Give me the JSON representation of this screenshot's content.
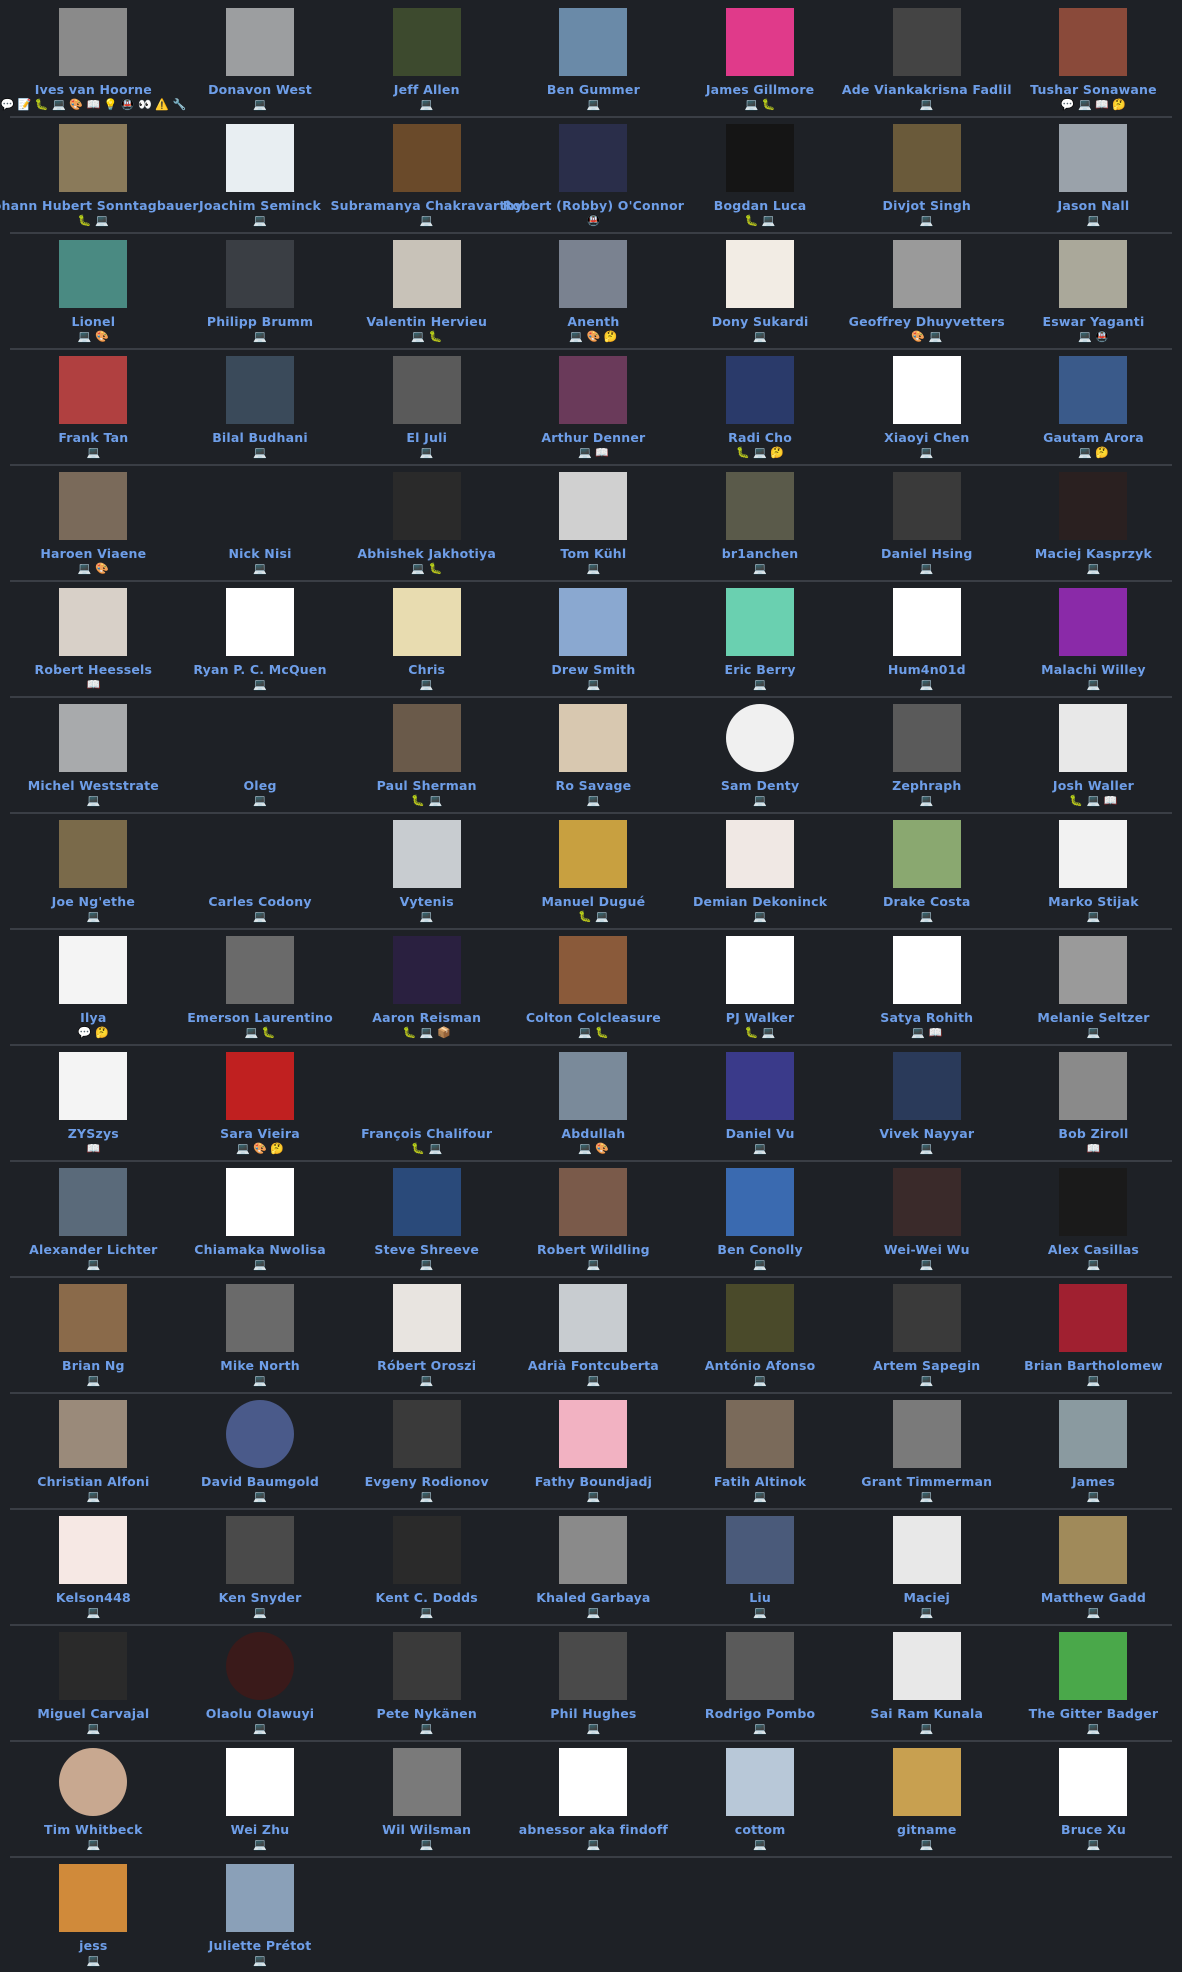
{
  "contributors": [
    {
      "name": "Ives van Hoorne",
      "badges": "💬 📝 🐛 💻 🎨 📖 💡 🚇 👀 ⚠️ 🔧",
      "color": "#8a8a8a"
    },
    {
      "name": "Donavon West",
      "badges": "💻",
      "color": "#9c9ea0"
    },
    {
      "name": "Jeff Allen",
      "badges": "💻",
      "color": "#3d4a2e"
    },
    {
      "name": "Ben Gummer",
      "badges": "💻",
      "color": "#6a8aa8"
    },
    {
      "name": "James Gillmore",
      "badges": "💻 🐛",
      "color": "#e03a8a"
    },
    {
      "name": "Ade Viankakrisna Fadlil",
      "badges": "💻",
      "color": "#444444"
    },
    {
      "name": "Tushar Sonawane",
      "badges": "💬 💻 📖 🤔",
      "color": "#8a4a3a"
    },
    {
      "name": "Johann Hubert Sonntagbauer",
      "badges": "🐛 💻",
      "color": "#8a7a5a"
    },
    {
      "name": "Joachim Seminck",
      "badges": "💻",
      "color": "#e8eef2"
    },
    {
      "name": "Subramanya Chakravarthy",
      "badges": "💻",
      "color": "#6a4a2a"
    },
    {
      "name": "Robert (Robby) O'Connor",
      "badges": "🚇",
      "color": "#2a2e4a"
    },
    {
      "name": "Bogdan Luca",
      "badges": "🐛 💻",
      "color": "#151515"
    },
    {
      "name": "Divjot Singh",
      "badges": "💻",
      "color": "#6a5a3a"
    },
    {
      "name": "Jason Nall",
      "badges": "💻",
      "color": "#9aa2aa"
    },
    {
      "name": "Lionel",
      "badges": "💻 🎨",
      "color": "#4a8a82"
    },
    {
      "name": "Philipp Brumm",
      "badges": "💻",
      "color": "#3a3e44"
    },
    {
      "name": "Valentin Hervieu",
      "badges": "💻 🐛",
      "color": "#c8c2b8"
    },
    {
      "name": "Anenth",
      "badges": "💻 🎨 🤔",
      "color": "#7a8290"
    },
    {
      "name": "Dony Sukardi",
      "badges": "💻",
      "color": "#f2ece4"
    },
    {
      "name": "Geoffrey Dhuyvetters",
      "badges": "🎨 💻",
      "color": "#9a9a9a"
    },
    {
      "name": "Eswar Yaganti",
      "badges": "💻 🚇",
      "color": "#aaa89a"
    },
    {
      "name": "Frank Tan",
      "badges": "💻",
      "color": "#b04040"
    },
    {
      "name": "Bilal Budhani",
      "badges": "💻",
      "color": "#3a4a5a"
    },
    {
      "name": "El Juli",
      "badges": "💻",
      "color": "#5a5a5a"
    },
    {
      "name": "Arthur Denner",
      "badges": "💻 📖",
      "color": "#6a3a5a"
    },
    {
      "name": "Radi Cho",
      "badges": "🐛 💻 🤔",
      "color": "#2a3a6a"
    },
    {
      "name": "Xiaoyi Chen",
      "badges": "💻",
      "color": "#ffffff"
    },
    {
      "name": "Gautam Arora",
      "badges": "💻 🤔",
      "color": "#3a5a8a"
    },
    {
      "name": "Haroen Viaene",
      "badges": "💻 🎨",
      "color": "#7a6a5a"
    },
    {
      "name": "Nick Nisi",
      "badges": "💻",
      "color": "#1e2126"
    },
    {
      "name": "Abhishek Jakhotiya",
      "badges": "💻 🐛",
      "color": "#2a2a2a"
    },
    {
      "name": "Tom Kühl",
      "badges": "💻",
      "color": "#d0d0d0"
    },
    {
      "name": "br1anchen",
      "badges": "💻",
      "color": "#5a5a4a"
    },
    {
      "name": "Daniel Hsing",
      "badges": "💻",
      "color": "#3a3a3a"
    },
    {
      "name": "Maciej Kasprzyk",
      "badges": "💻",
      "color": "#2a2020"
    },
    {
      "name": "Robert Heessels",
      "badges": "📖",
      "color": "#d8d0c8"
    },
    {
      "name": "Ryan P. C. McQuen",
      "badges": "💻",
      "color": "#ffffff"
    },
    {
      "name": "Chris",
      "badges": "💻",
      "color": "#e8dcb0"
    },
    {
      "name": "Drew Smith",
      "badges": "💻",
      "color": "#8aa8d0"
    },
    {
      "name": "Eric Berry",
      "badges": "💻",
      "color": "#6ad0b0"
    },
    {
      "name": "Hum4n01d",
      "badges": "💻",
      "color": "#ffffff"
    },
    {
      "name": "Malachi Willey",
      "badges": "💻",
      "color": "#8a2aa8"
    },
    {
      "name": "Michel Weststrate",
      "badges": "💻",
      "color": "#a8aaac"
    },
    {
      "name": "Oleg",
      "badges": "💻",
      "color": "#1e2126"
    },
    {
      "name": "Paul Sherman",
      "badges": "🐛 💻",
      "color": "#6a5a4a"
    },
    {
      "name": "Ro Savage",
      "badges": "💻",
      "color": "#d8c8b0"
    },
    {
      "name": "Sam Denty",
      "badges": "💻",
      "color": "#f0f0f0"
    },
    {
      "name": "Zephraph",
      "badges": "💻",
      "color": "#5a5a5a"
    },
    {
      "name": "Josh Waller",
      "badges": "🐛 💻 📖",
      "color": "#e8e8e8"
    },
    {
      "name": "Joe Ng'ethe",
      "badges": "💻",
      "color": "#7a6a4a"
    },
    {
      "name": "Carles Codony",
      "badges": "💻",
      "color": "#1e2126"
    },
    {
      "name": "Vytenis",
      "badges": "💻",
      "color": "#c8ccd0"
    },
    {
      "name": "Manuel Dugué",
      "badges": "🐛 💻",
      "color": "#c8a040"
    },
    {
      "name": "Demian Dekoninck",
      "badges": "💻",
      "color": "#f0e8e4"
    },
    {
      "name": "Drake Costa",
      "badges": "💻",
      "color": "#8aa870"
    },
    {
      "name": "Marko Stijak",
      "badges": "💻",
      "color": "#f2f2f2"
    },
    {
      "name": "Ilya",
      "badges": "💬 🤔",
      "color": "#f4f4f4"
    },
    {
      "name": "Emerson Laurentino",
      "badges": "💻 🐛",
      "color": "#6a6a6a"
    },
    {
      "name": "Aaron Reisman",
      "badges": "🐛 💻 📦",
      "color": "#2a2040"
    },
    {
      "name": "Colton Colcleasure",
      "badges": "💻 🐛",
      "color": "#8a5a3a"
    },
    {
      "name": "PJ Walker",
      "badges": "🐛 💻",
      "color": "#ffffff"
    },
    {
      "name": "Satya Rohith",
      "badges": "💻 📖",
      "color": "#ffffff"
    },
    {
      "name": "Melanie Seltzer",
      "badges": "💻",
      "color": "#9a9a9a"
    },
    {
      "name": "ZYSzys",
      "badges": "📖",
      "color": "#f4f4f4"
    },
    {
      "name": "Sara Vieira",
      "badges": "💻 🎨 🤔",
      "color": "#c02020"
    },
    {
      "name": "François Chalifour",
      "badges": "🐛 💻",
      "color": "#1e2126"
    },
    {
      "name": "Abdullah",
      "badges": "💻 🎨",
      "color": "#7a8a9a"
    },
    {
      "name": "Daniel Vu",
      "badges": "💻",
      "color": "#3a3a8a"
    },
    {
      "name": "Vivek Nayyar",
      "badges": "💻",
      "color": "#2a3a5a"
    },
    {
      "name": "Bob Ziroll",
      "badges": "📖",
      "color": "#8a8a8a"
    },
    {
      "name": "Alexander Lichter",
      "badges": "💻",
      "color": "#5a6a7a"
    },
    {
      "name": "Chiamaka Nwolisa",
      "badges": "💻",
      "color": "#ffffff"
    },
    {
      "name": "Steve Shreeve",
      "badges": "💻",
      "color": "#2a4a7a"
    },
    {
      "name": "Robert Wildling",
      "badges": "💻",
      "color": "#7a5a4a"
    },
    {
      "name": "Ben Conolly",
      "badges": "💻",
      "color": "#3a6ab0"
    },
    {
      "name": "Wei-Wei Wu",
      "badges": "💻",
      "color": "#3a2a2a"
    },
    {
      "name": "Alex Casillas",
      "badges": "💻",
      "color": "#1a1a1a"
    },
    {
      "name": "Brian Ng",
      "badges": "💻",
      "color": "#8a6a4a"
    },
    {
      "name": "Mike North",
      "badges": "💻",
      "color": "#6a6a6a"
    },
    {
      "name": "Róbert Oroszi",
      "badges": "💻",
      "color": "#e8e4e0"
    },
    {
      "name": "Adrià Fontcuberta",
      "badges": "💻",
      "color": "#c8ccd0"
    },
    {
      "name": "António Afonso",
      "badges": "💻",
      "color": "#4a4a2a"
    },
    {
      "name": "Artem Sapegin",
      "badges": "💻",
      "color": "#3a3a3a"
    },
    {
      "name": "Brian Bartholomew",
      "badges": "💻",
      "color": "#a02030"
    },
    {
      "name": "Christian Alfoni",
      "badges": "💻",
      "color": "#9a8a7a"
    },
    {
      "name": "David Baumgold",
      "badges": "💻",
      "color": "#4a5a8a"
    },
    {
      "name": "Evgeny Rodionov",
      "badges": "💻",
      "color": "#3a3a3a"
    },
    {
      "name": "Fathy Boundjadj",
      "badges": "💻",
      "color": "#f2b2c2"
    },
    {
      "name": "Fatih Altinok",
      "badges": "💻",
      "color": "#7a6a5a"
    },
    {
      "name": "Grant Timmerman",
      "badges": "💻",
      "color": "#7a7a7a"
    },
    {
      "name": "James",
      "badges": "💻",
      "color": "#8a9aa0"
    },
    {
      "name": "Kelson448",
      "badges": "💻",
      "color": "#f6e8e4"
    },
    {
      "name": "Ken Snyder",
      "badges": "💻",
      "color": "#4a4a4a"
    },
    {
      "name": "Kent C. Dodds",
      "badges": "💻",
      "color": "#2a2a2a"
    },
    {
      "name": "Khaled Garbaya",
      "badges": "💻",
      "color": "#8a8a8a"
    },
    {
      "name": "Liu",
      "badges": "💻",
      "color": "#4a5a7a"
    },
    {
      "name": "Maciej",
      "badges": "💻",
      "color": "#e8e8e8"
    },
    {
      "name": "Matthew Gadd",
      "badges": "💻",
      "color": "#a08a5a"
    },
    {
      "name": "Miguel Carvajal",
      "badges": "💻",
      "color": "#2a2a2a"
    },
    {
      "name": "Olaolu Olawuyi",
      "badges": "💻",
      "color": "#3a1a1a"
    },
    {
      "name": "Pete Nykänen",
      "badges": "💻",
      "color": "#3a3a3a"
    },
    {
      "name": "Phil Hughes",
      "badges": "💻",
      "color": "#4a4a4a"
    },
    {
      "name": "Rodrigo Pombo",
      "badges": "💻",
      "color": "#5a5a5a"
    },
    {
      "name": "Sai Ram Kunala",
      "badges": "💻",
      "color": "#e8e8e8"
    },
    {
      "name": "The Gitter Badger",
      "badges": "💻",
      "color": "#4aa84a"
    },
    {
      "name": "Tim Whitbeck",
      "badges": "💻",
      "color": "#c8a890"
    },
    {
      "name": "Wei Zhu",
      "badges": "💻",
      "color": "#ffffff"
    },
    {
      "name": "Wil Wilsman",
      "badges": "💻",
      "color": "#7a7a7a"
    },
    {
      "name": "abnessor aka findoff",
      "badges": "💻",
      "color": "#ffffff"
    },
    {
      "name": "cottom",
      "badges": "💻",
      "color": "#b8c8d8"
    },
    {
      "name": "gitname",
      "badges": "💻",
      "color": "#c8a050"
    },
    {
      "name": "Bruce Xu",
      "badges": "💻",
      "color": "#ffffff"
    },
    {
      "name": "jess",
      "badges": "💻",
      "color": "#d08a3a"
    },
    {
      "name": "Juliette Prétot",
      "badges": "💻",
      "color": "#8aa0b8"
    }
  ]
}
